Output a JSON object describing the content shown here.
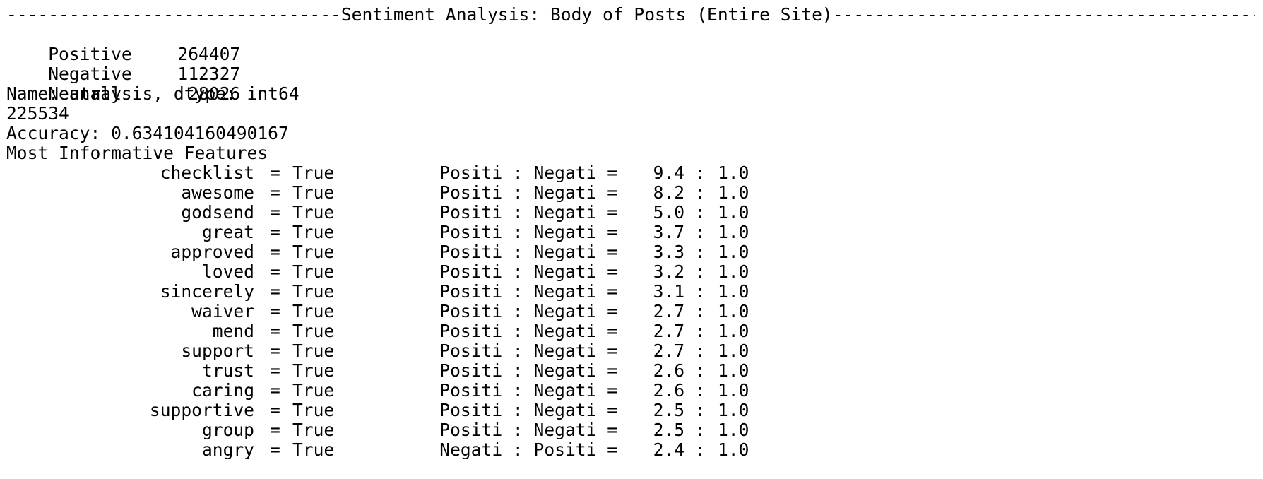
{
  "output": {
    "header_title": "Sentiment Analysis: Body of Posts (Entire Site)",
    "header_dashes_left": "--------------------------------",
    "header_dashes_right": "----------------------------------------------------------------------------------------------------------",
    "counts": [
      {
        "label": "Positive",
        "value": "264407"
      },
      {
        "label": "Negative",
        "value": "112327"
      },
      {
        "label": "Neutral",
        "value": "28026"
      }
    ],
    "series_info": "Name: analysis, dtype: int64",
    "total": "225534",
    "accuracy": "Accuracy: 0.634104160490167",
    "features_heading": "Most Informative Features",
    "features": [
      {
        "name": "checklist",
        "value": "True",
        "label": "Positi : Negati",
        "ratio": "9.4",
        "base": "1.0"
      },
      {
        "name": "awesome",
        "value": "True",
        "label": "Positi : Negati",
        "ratio": "8.2",
        "base": "1.0"
      },
      {
        "name": "godsend",
        "value": "True",
        "label": "Positi : Negati",
        "ratio": "5.0",
        "base": "1.0"
      },
      {
        "name": "great",
        "value": "True",
        "label": "Positi : Negati",
        "ratio": "3.7",
        "base": "1.0"
      },
      {
        "name": "approved",
        "value": "True",
        "label": "Positi : Negati",
        "ratio": "3.3",
        "base": "1.0"
      },
      {
        "name": "loved",
        "value": "True",
        "label": "Positi : Negati",
        "ratio": "3.2",
        "base": "1.0"
      },
      {
        "name": "sincerely",
        "value": "True",
        "label": "Positi : Negati",
        "ratio": "3.1",
        "base": "1.0"
      },
      {
        "name": "waiver",
        "value": "True",
        "label": "Positi : Negati",
        "ratio": "2.7",
        "base": "1.0"
      },
      {
        "name": "mend",
        "value": "True",
        "label": "Positi : Negati",
        "ratio": "2.7",
        "base": "1.0"
      },
      {
        "name": "support",
        "value": "True",
        "label": "Positi : Negati",
        "ratio": "2.7",
        "base": "1.0"
      },
      {
        "name": "trust",
        "value": "True",
        "label": "Positi : Negati",
        "ratio": "2.6",
        "base": "1.0"
      },
      {
        "name": "caring",
        "value": "True",
        "label": "Positi : Negati",
        "ratio": "2.6",
        "base": "1.0"
      },
      {
        "name": "supportive",
        "value": "True",
        "label": "Positi : Negati",
        "ratio": "2.5",
        "base": "1.0"
      },
      {
        "name": "group",
        "value": "True",
        "label": "Positi : Negati",
        "ratio": "2.5",
        "base": "1.0"
      },
      {
        "name": "angry",
        "value": "True",
        "label": "Negati : Positi",
        "ratio": "2.4",
        "base": "1.0"
      }
    ]
  }
}
